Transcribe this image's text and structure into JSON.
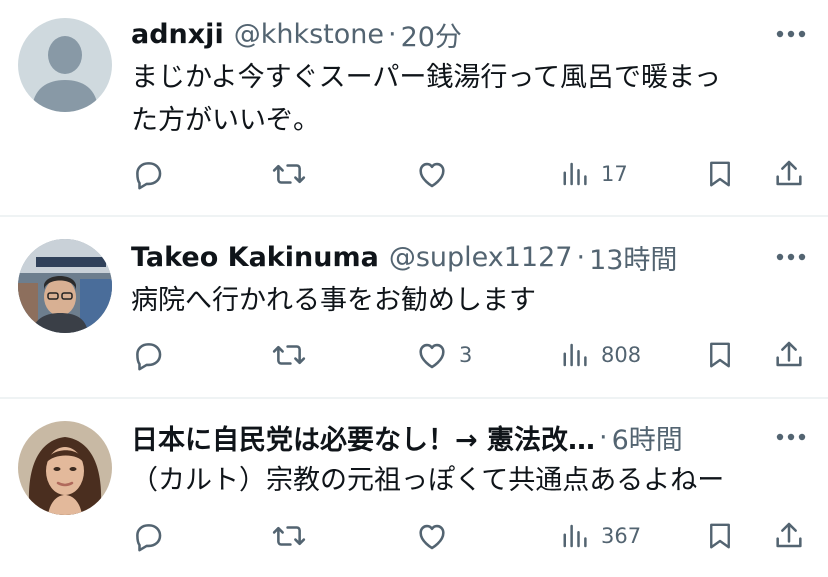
{
  "replies": [
    {
      "display_name": "adnxji",
      "handle": "@khkstone",
      "separator": "·",
      "time": "20分",
      "text_lines": [
        "まじかよ今すぐスーパー銭湯行って風呂で暖まっ",
        "た方がいいぞ。"
      ],
      "reply_count": "",
      "retweet_count": "",
      "like_count": "",
      "views_count": "17",
      "avatar": "default-avatar"
    },
    {
      "display_name": "Takeo Kakinuma",
      "handle": "@suplex1127",
      "separator": "·",
      "time": "13時間",
      "text_lines": [
        "病院へ行かれる事をお勧めします"
      ],
      "reply_count": "",
      "retweet_count": "",
      "like_count": "3",
      "views_count": "808",
      "avatar": "photo-avatar-man"
    },
    {
      "display_name": "日本に自民党は必要なし！→ 憲法改…",
      "handle": "",
      "separator": "·",
      "time": "6時間",
      "text_lines": [
        "（カルト）宗教の元祖っぽくて共通点あるよねー"
      ],
      "reply_count": "",
      "retweet_count": "",
      "like_count": "",
      "views_count": "367",
      "avatar": "photo-avatar-woman"
    }
  ],
  "colors": {
    "text": "#0f1419",
    "secondary": "#536471",
    "divider": "#eff3f4",
    "default_avatar_bg": "#cfd9de"
  },
  "icons": [
    "reply-icon",
    "retweet-icon",
    "like-icon",
    "views-icon",
    "bookmark-icon",
    "share-icon",
    "more-icon"
  ]
}
